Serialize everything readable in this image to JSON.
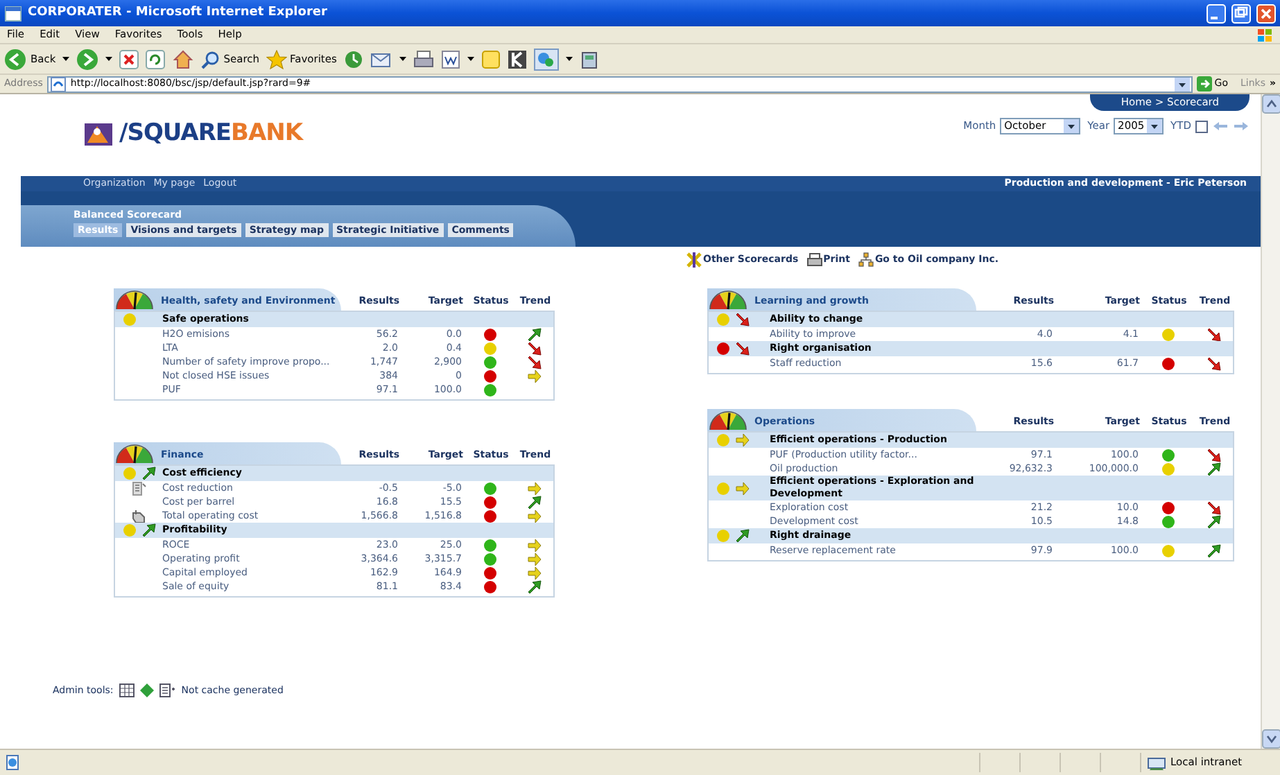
{
  "window": {
    "title": "CORPORATER - Microsoft Internet Explorer"
  },
  "menu": [
    "File",
    "Edit",
    "View",
    "Favorites",
    "Tools",
    "Help"
  ],
  "toolbar": {
    "back": "Back",
    "search": "Search",
    "favorites": "Favorites"
  },
  "address_bar": {
    "label": "Address",
    "url": "http://localhost:8080/bsc/jsp/default.jsp?rard=9#",
    "go": "Go",
    "links": "Links",
    "more": "»"
  },
  "header": {
    "logo_prefix": "/SQUARE",
    "logo_suffix": "BANK",
    "breadcrumb": "Home > Scorecard",
    "month_label": "Month",
    "month": "October",
    "year_label": "Year",
    "year": "2005",
    "ytd_label": "YTD",
    "ytd_checked": false
  },
  "nav": {
    "links": [
      "Organization",
      "My page",
      "Logout"
    ],
    "context": "Production and development - Eric Peterson"
  },
  "section": {
    "title": "Balanced Scorecard",
    "tabs": [
      {
        "label": "Results",
        "selected": true
      },
      {
        "label": "Visions and targets",
        "selected": false
      },
      {
        "label": "Strategy map",
        "selected": false
      },
      {
        "label": "Strategic Initiative",
        "selected": false
      },
      {
        "label": "Comments",
        "selected": false
      }
    ]
  },
  "actions": [
    "Other Scorecards",
    "Print",
    "Go to Oil company Inc."
  ],
  "left_column": [
    {
      "title": "Health, safety and Environment",
      "columns": [
        "Results",
        "Target",
        "Status",
        "Trend"
      ],
      "groups": [
        {
          "name": "Safe operations",
          "status": {
            "color": "#e8d000"
          },
          "rows": [
            {
              "name": "H2O emisions",
              "results": "56.2",
              "target": "0.0",
              "status": {
                "color": "#d40000"
              },
              "trend": {
                "kind": "up"
              }
            },
            {
              "name": "LTA",
              "results": "2.0",
              "target": "0.4",
              "status": {
                "color": "#e8d000"
              },
              "trend": {
                "kind": "down"
              }
            },
            {
              "name": "Number of safety improve propo...",
              "results": "1,747",
              "target": "2,900",
              "status": {
                "color": "#2fb51a"
              },
              "trend": {
                "kind": "down"
              }
            },
            {
              "name": "Not closed HSE issues",
              "results": "384",
              "target": "0",
              "status": {
                "color": "#d40000"
              },
              "trend": {
                "kind": "flat"
              }
            },
            {
              "name": "PUF",
              "results": "97.1",
              "target": "100.0",
              "status": {
                "color": "#2fb51a"
              }
            }
          ]
        }
      ]
    },
    {
      "title": "Finance",
      "columns": [
        "Results",
        "Target",
        "Status",
        "Trend"
      ],
      "groups": [
        {
          "name": "Cost efficiency",
          "status": {
            "color": "#e8d000"
          },
          "trend": {
            "kind": "up"
          },
          "rows": [
            {
              "name": "Cost reduction",
              "results": "-0.5",
              "target": "-5.0",
              "status": {
                "color": "#2fb51a"
              },
              "trend": {
                "kind": "flat"
              },
              "annotation": {
                "kind": "chart"
              }
            },
            {
              "name": "Cost per barrel",
              "results": "16.8",
              "target": "15.5",
              "status": {
                "color": "#d40000"
              },
              "trend": {
                "kind": "up"
              }
            },
            {
              "name": "Total operating cost",
              "results": "1,566.8",
              "target": "1,516.8",
              "status": {
                "color": "#d40000"
              },
              "trend": {
                "kind": "flat"
              },
              "annotation": {
                "kind": "comment"
              }
            }
          ]
        },
        {
          "name": "Profitability",
          "status": {
            "color": "#e8d000"
          },
          "trend": {
            "kind": "up"
          },
          "rows": [
            {
              "name": "ROCE",
              "results": "23.0",
              "target": "25.0",
              "status": {
                "color": "#2fb51a"
              },
              "trend": {
                "kind": "flat"
              }
            },
            {
              "name": "Operating profit",
              "results": "3,364.6",
              "target": "3,315.7",
              "status": {
                "color": "#2fb51a"
              },
              "trend": {
                "kind": "flat"
              }
            },
            {
              "name": "Capital employed",
              "results": "162.9",
              "target": "164.9",
              "status": {
                "color": "#d40000"
              },
              "trend": {
                "kind": "flat"
              }
            },
            {
              "name": "Sale of equity",
              "results": "81.1",
              "target": "83.4",
              "status": {
                "color": "#d40000"
              },
              "trend": {
                "kind": "up"
              }
            }
          ]
        }
      ]
    }
  ],
  "right_column": [
    {
      "title": "Learning and growth",
      "columns": [
        "Results",
        "Target",
        "Status",
        "Trend"
      ],
      "groups": [
        {
          "name": "Ability to change",
          "status": {
            "color": "#e8d000"
          },
          "trend": {
            "kind": "down"
          },
          "rows": [
            {
              "name": "Ability to improve",
              "results": "4.0",
              "target": "4.1",
              "status": {
                "color": "#e8d000"
              },
              "trend": {
                "kind": "down"
              }
            }
          ]
        },
        {
          "name": "Right organisation",
          "status": {
            "color": "#d40000"
          },
          "trend": {
            "kind": "down"
          },
          "rows": [
            {
              "name": "Staff reduction",
              "results": "15.6",
              "target": "61.7",
              "status": {
                "color": "#d40000"
              },
              "trend": {
                "kind": "down"
              }
            }
          ]
        }
      ]
    },
    {
      "title": "Operations",
      "columns": [
        "Results",
        "Target",
        "Status",
        "Trend"
      ],
      "groups": [
        {
          "name": "Efficient operations - Production",
          "status": {
            "color": "#e8d000"
          },
          "trend": {
            "kind": "flat"
          },
          "rows": [
            {
              "name": "PUF (Production utility factor...",
              "results": "97.1",
              "target": "100.0",
              "status": {
                "color": "#2fb51a"
              },
              "trend": {
                "kind": "down"
              }
            },
            {
              "name": "Oil production",
              "results": "92,632.3",
              "target": "100,000.0",
              "status": {
                "color": "#e8d000"
              },
              "trend": {
                "kind": "up"
              }
            }
          ]
        },
        {
          "name": "Efficient operations - Exploration and Development",
          "status": {
            "color": "#e8d000"
          },
          "trend": {
            "kind": "flat"
          },
          "rows": [
            {
              "name": "Exploration cost",
              "results": "21.2",
              "target": "10.0",
              "status": {
                "color": "#d40000"
              },
              "trend": {
                "kind": "down"
              }
            },
            {
              "name": "Development cost",
              "results": "10.5",
              "target": "14.8",
              "status": {
                "color": "#2fb51a"
              },
              "trend": {
                "kind": "up"
              }
            }
          ]
        },
        {
          "name": "Right drainage",
          "status": {
            "color": "#e8d000"
          },
          "trend": {
            "kind": "up"
          },
          "rows": [
            {
              "name": "Reserve replacement rate",
              "results": "97.9",
              "target": "100.0",
              "status": {
                "color": "#e8d000"
              },
              "trend": {
                "kind": "up"
              }
            }
          ]
        }
      ]
    }
  ],
  "admin": {
    "label": "Admin tools:",
    "note": "Not cache generated"
  },
  "status_bar": {
    "zone": "Local intranet"
  }
}
